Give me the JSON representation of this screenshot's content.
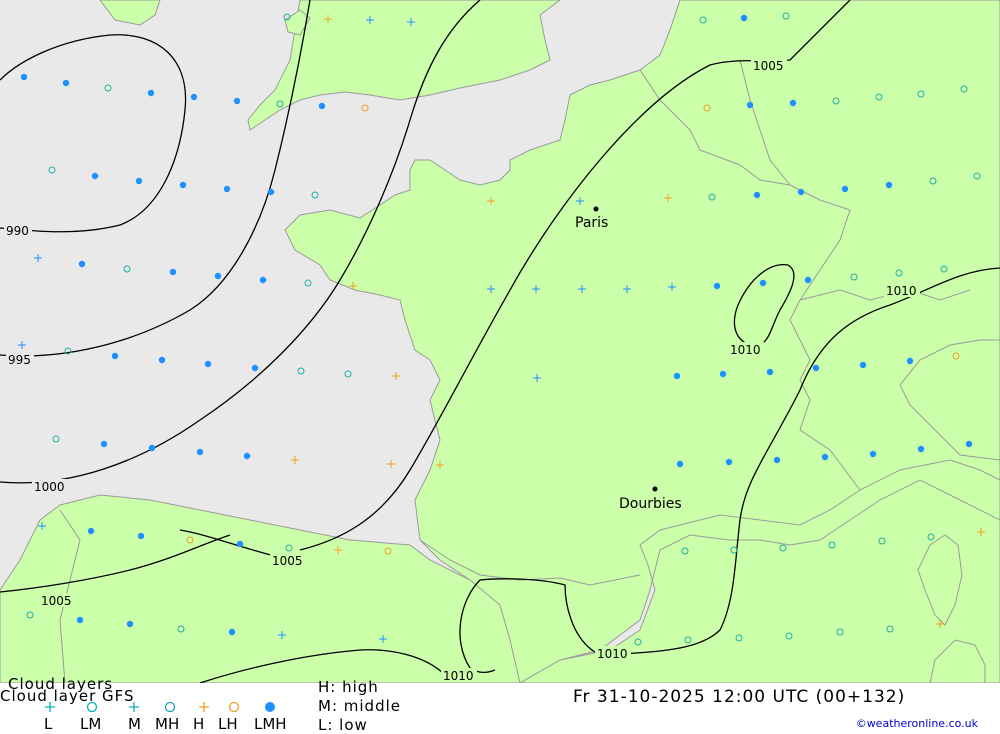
{
  "header": {
    "title_line1": "Cloud layers",
    "title_line2": "Cloud layer   GFS",
    "key_high": "H: high",
    "key_middle": "M: middle",
    "key_low": "L: low",
    "datetime": "Fr 31-10-2025 12:00 UTC (00+132)",
    "credit": "©weatheronline.co.uk"
  },
  "legend": [
    {
      "code": "L",
      "symbol": "cross",
      "color": "#00b4b4"
    },
    {
      "code": "LM",
      "symbol": "ring",
      "color": "#00b4b4"
    },
    {
      "code": "M",
      "symbol": "cross",
      "color": "#1aa3b8"
    },
    {
      "code": "MH",
      "symbol": "ring",
      "color": "#1aa3b8"
    },
    {
      "code": "H",
      "symbol": "cross",
      "color": "#f0a020"
    },
    {
      "code": "LH",
      "symbol": "ring",
      "color": "#f0a020"
    },
    {
      "code": "LMH",
      "symbol": "dot",
      "color": "#1e90ff"
    }
  ],
  "cities": [
    {
      "name": "Paris"
    },
    {
      "name": "Dourbies"
    }
  ],
  "isobars": [
    "990",
    "995",
    "1000",
    "1005",
    "1005",
    "1005",
    "1005",
    "1010",
    "1010",
    "1010",
    "1010"
  ],
  "colors": {
    "land": "#ccffaa",
    "sea": "#e9e9e9",
    "border": "#9a9a9a",
    "isobar": "#000000",
    "dot": "#1e90ff",
    "teal": "#20b0a0",
    "orange": "#f0a020"
  }
}
